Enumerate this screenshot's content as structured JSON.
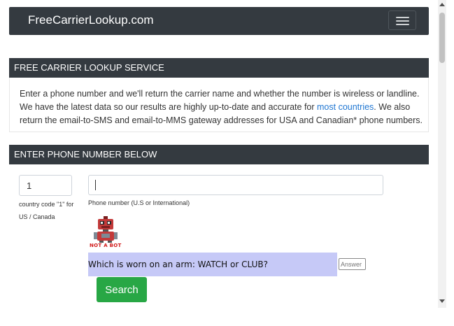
{
  "navbar": {
    "brand": "FreeCarrierLookup.com",
    "menu_icon": "hamburger-menu-icon"
  },
  "service_section": {
    "heading": "FREE CARRIER LOOKUP SERVICE",
    "intro_before_link": "Enter a phone number and we'll return the carrier name and whether the number is wireless or landline. We have the latest data so our results are highly up-to-date and accurate for ",
    "intro_link": "most countries",
    "intro_after_link": ". We also return the email-to-SMS and email-to-MMS gateway addresses for USA and Canadian* phone numbers."
  },
  "form_section": {
    "heading": "ENTER PHONE NUMBER BELOW",
    "country_code_value": "1",
    "country_code_help": "country code \"1\" for US / Canada",
    "phone_value": "",
    "phone_help": "Phone number (U.S or International)",
    "robot_label": "NOT A BOT",
    "robot_icon": "robot-icon",
    "captcha_question": "Which is worn on an arm: WATCH or CLUB?",
    "answer_placeholder": "Answer",
    "search_label": "Search"
  },
  "colors": {
    "navbar_bg": "#343a40",
    "link": "#1f76d2",
    "search_button": "#28a745",
    "captcha_bg": "#c6c9f7"
  }
}
